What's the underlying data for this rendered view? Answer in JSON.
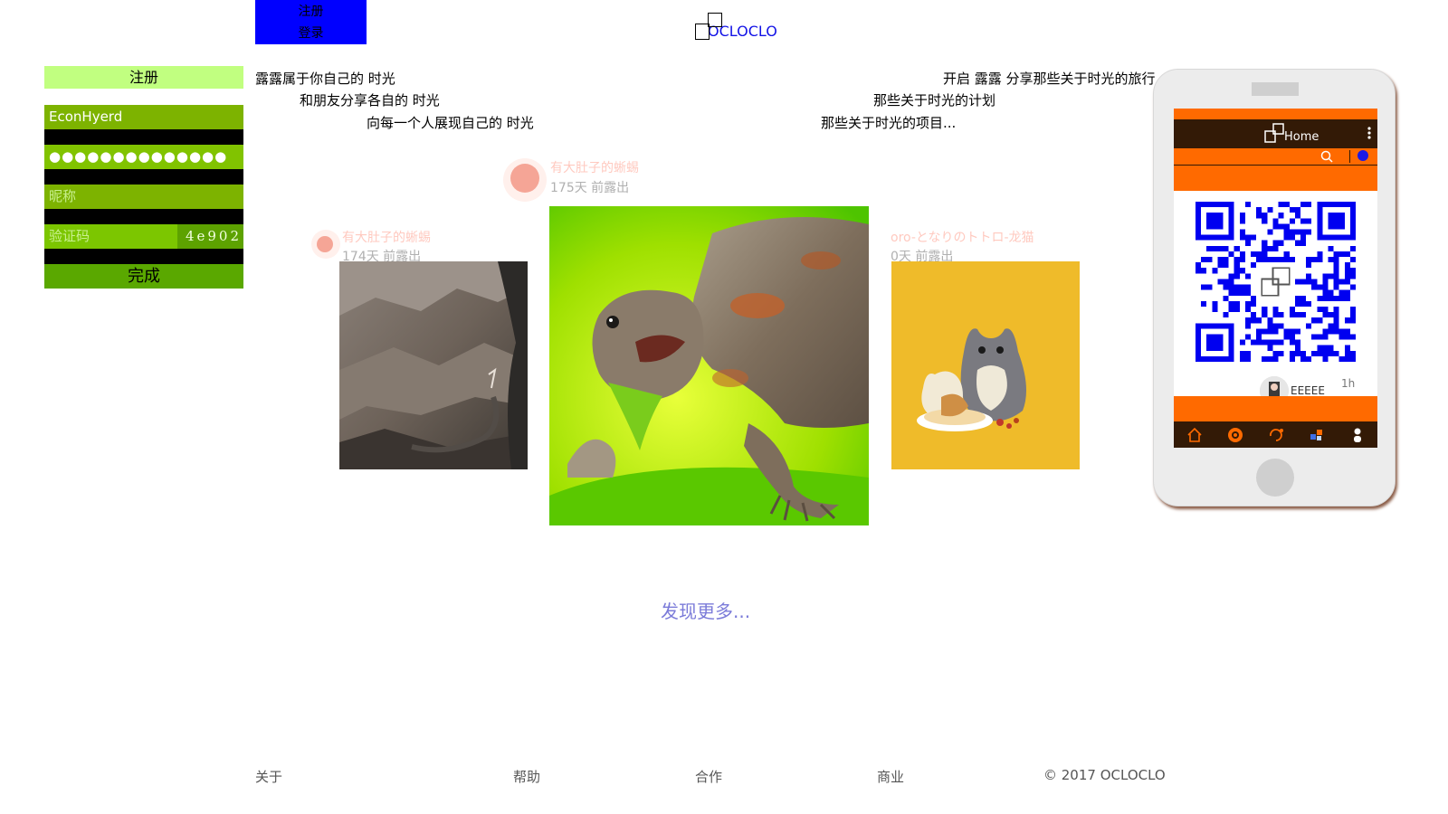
{
  "topnav": {
    "register": "注册",
    "login": "登录"
  },
  "logo": {
    "text": "OCLOCLO"
  },
  "register": {
    "title": "注册",
    "username": "EconHyerd",
    "password": "●●●●●●●●●●●●●●",
    "nickname_placeholder": "昵称",
    "captcha_placeholder": "验证码",
    "captcha_code": "4e902",
    "submit": "完成"
  },
  "intro": {
    "left": [
      "露露属于你自己的 时光",
      "和朋友分享各自的 时光",
      "向每一个人展现自己的 时光"
    ],
    "right": [
      "开启 露露 分享那些关于时光的旅行",
      "那些关于时光的计划",
      "那些关于时光的项目..."
    ]
  },
  "cards": [
    {
      "user": "有大肚子的蜥蜴",
      "time": "174天 前露出"
    },
    {
      "user": "有大肚子的蜥蜴",
      "time": "175天 前露出"
    },
    {
      "user": "oro-となりのトトロ-龙猫",
      "time": "0天 前露出"
    }
  ],
  "more": "发现更多...",
  "footer": {
    "links": [
      "关于",
      "帮助",
      "合作",
      "商业"
    ],
    "copyright": "© 2017 OCLOCLO"
  },
  "phone": {
    "header_title": "Home",
    "post_user": "EEEEE",
    "post_time": "1h"
  },
  "colors": {
    "accent_orange": "#ff6a00",
    "nav_blue": "#0000ff",
    "form_green": "#7db300",
    "link_blue": "#1212e6"
  }
}
